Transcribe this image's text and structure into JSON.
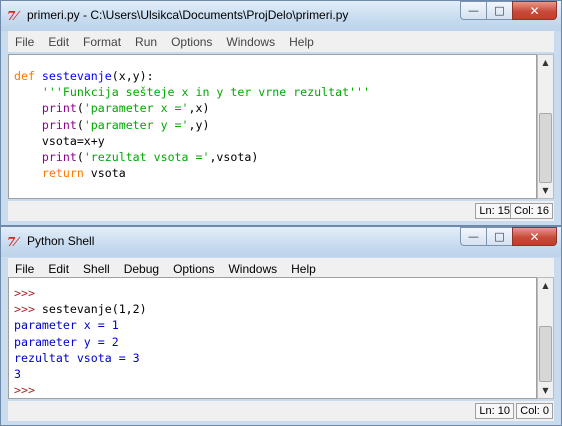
{
  "editor": {
    "title": "primeri.py - C:\\Users\\Ulsikca\\Documents\\ProjDelo\\primeri.py",
    "icon": "idle-logo-icon",
    "menu": [
      "File",
      "Edit",
      "Format",
      "Run",
      "Options",
      "Windows",
      "Help"
    ],
    "code": {
      "l1": {
        "kw": "def",
        "name": " sestevanje",
        "rest": "(x,y):"
      },
      "l2": {
        "indent": "    ",
        "str": "'''Funkcija sešteje x in y ter vrne rezultat'''"
      },
      "l3": {
        "indent": "    ",
        "fn": "print",
        "p1": "(",
        "str": "'parameter x ='",
        "p2": ",x)"
      },
      "l4": {
        "indent": "    ",
        "fn": "print",
        "p1": "(",
        "str": "'parameter y ='",
        "p2": ",y)"
      },
      "l5": {
        "text": "    vsota=x+y"
      },
      "l6": {
        "indent": "    ",
        "fn": "print",
        "p1": "(",
        "str": "'rezultat vsota ='",
        "p2": ",vsota)"
      },
      "l7": {
        "indent": "    ",
        "kw": "return",
        "rest": " vsota"
      }
    },
    "status": {
      "ln": "Ln: 15",
      "col": "Col: 16"
    }
  },
  "shell": {
    "title": "Python Shell",
    "icon": "idle-logo-icon",
    "menu": [
      "File",
      "Edit",
      "Shell",
      "Debug",
      "Options",
      "Windows",
      "Help"
    ],
    "lines": {
      "l1": {
        "prompt": ">>>"
      },
      "l2": {
        "prompt": ">>> ",
        "input": "sestevanje(1,2)"
      },
      "l3": {
        "output": "parameter x = 1"
      },
      "l4": {
        "output": "parameter y = 2"
      },
      "l5": {
        "output": "rezultat vsota = 3"
      },
      "l6": {
        "output": "3"
      },
      "l7": {
        "prompt": ">>>"
      }
    },
    "status": {
      "ln": "Ln: 10",
      "col": "Col: 0"
    }
  },
  "window_controls": {
    "minimize": "—",
    "maximize": "□",
    "close": "✕"
  },
  "colors": {
    "keyword": "#ff7700",
    "definition": "#0000ff",
    "string": "#00aa00",
    "builtin": "#900090",
    "prompt": "#a52a2a",
    "stdout": "#0000cc"
  }
}
